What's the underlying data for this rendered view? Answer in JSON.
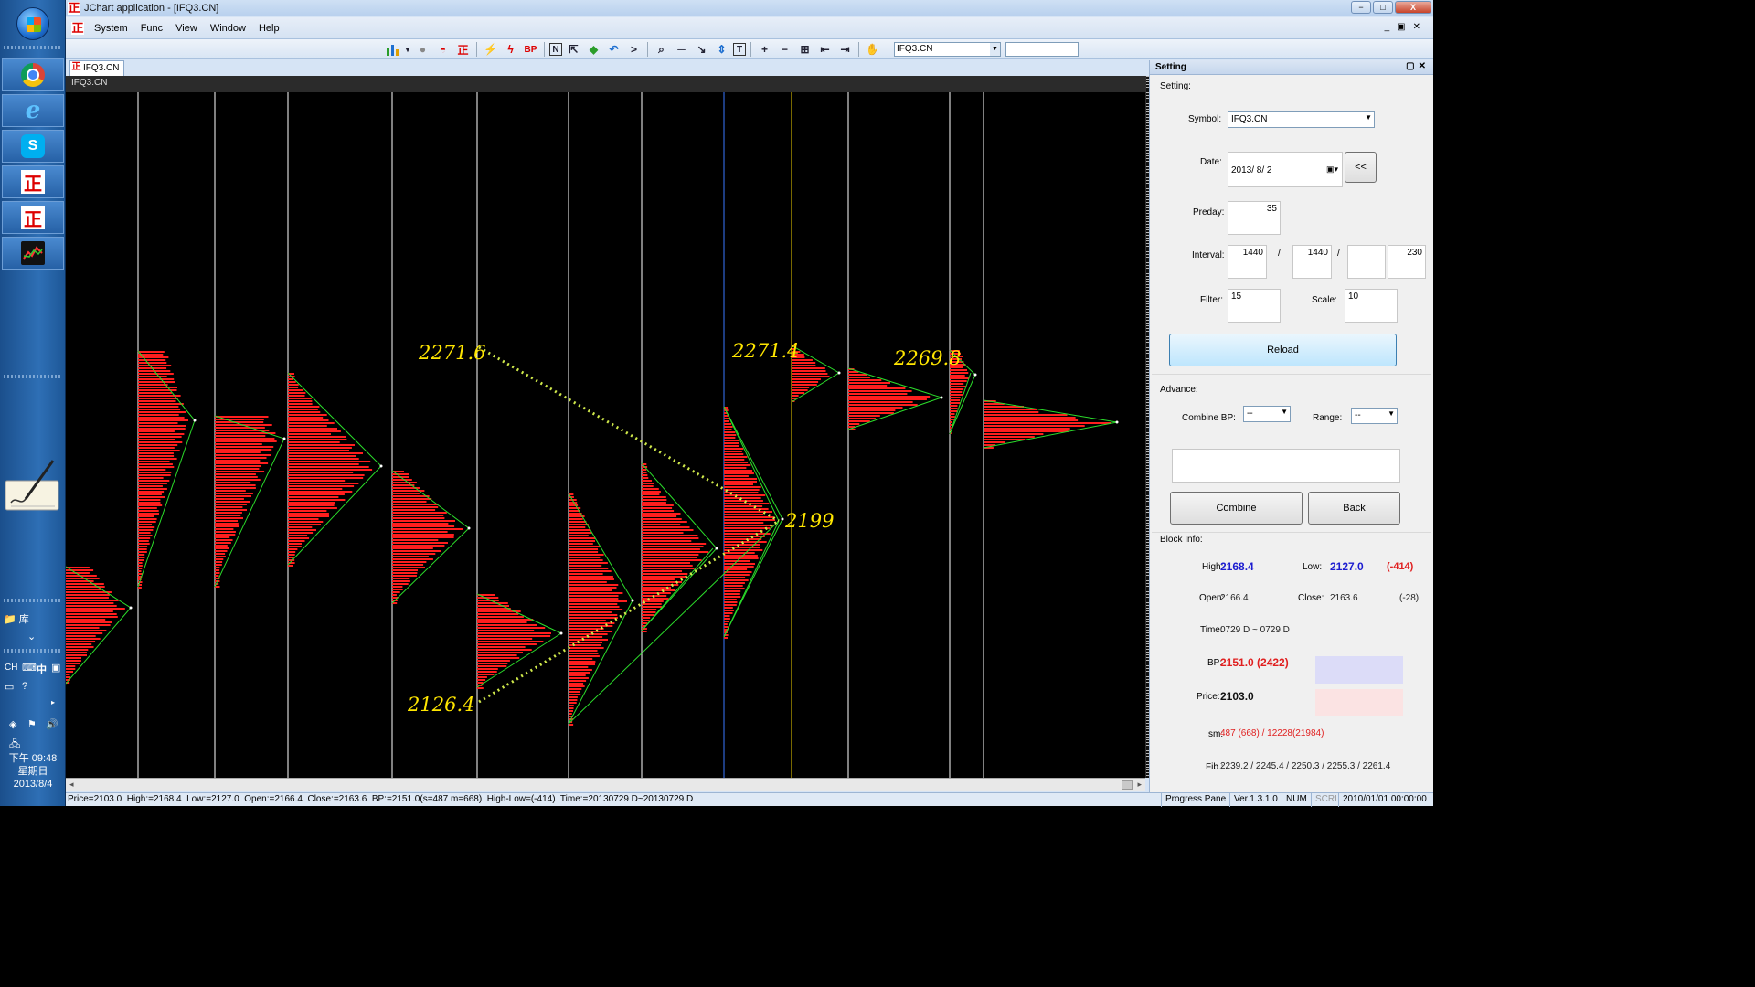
{
  "taskbar": {
    "language": "CH",
    "ime": "中",
    "library_label": "库",
    "clock": {
      "time": "下午 09:48",
      "weekday": "星期日",
      "date": "2013/8/4"
    }
  },
  "window": {
    "title": "JChart application - [IFQ3.CN]",
    "min_label": "−",
    "max_label": "□",
    "close_label": "X"
  },
  "menu": [
    "System",
    "Func",
    "View",
    "Window",
    "Help"
  ],
  "toolbar": {
    "bp_label": "BP",
    "symbol_combo": "IFQ3.CN",
    "search_value": ""
  },
  "document": {
    "tab_label": "IFQ3.CN",
    "header_label": "IFQ3.CN"
  },
  "chart_data": {
    "type": "market-profile",
    "annotations": [
      {
        "label": "2271.6",
        "kind": "high"
      },
      {
        "label": "2126.4",
        "kind": "low"
      },
      {
        "label": "2271.4",
        "kind": "high"
      },
      {
        "label": "2199",
        "kind": "pivot"
      },
      {
        "label": "2269.8",
        "kind": "high"
      }
    ],
    "separator_colors": {
      "default": "#ffffff",
      "blue": "#3a78ff",
      "yellow": "#f0d000"
    },
    "profile_color": "#ff1e1e",
    "trend_line_color": "#2bdc2b",
    "dotted_line_color": "#cfe84a",
    "label_color": "#ffe600"
  },
  "statusbar": {
    "price": "Price=2103.0",
    "high": "High:=2168.4",
    "low": "Low:=2127.0",
    "open": "Open:=2166.4",
    "close": "Close:=2163.6",
    "bp": "BP:=2151.0(s=487 m=668)",
    "high_low": "High-Low=(-414)",
    "time": "Time:=20130729 D~20130729 D",
    "progress_label": "Progress Pane",
    "version": "Ver.1.3.1.0",
    "num": "NUM",
    "scrl": "SCRL",
    "datetime": "2010/01/01 00:00:00"
  },
  "setting": {
    "title": "Setting",
    "section_setting": "Setting:",
    "symbol_label": "Symbol:",
    "symbol_value": "IFQ3.CN",
    "date_label": "Date:",
    "date_value": "2013/  8/  2",
    "back_date_label": "<<",
    "preday_label": "Preday:",
    "preday_value": "35",
    "interval_label": "Interval:",
    "interval_1": "1440",
    "interval_sep": "/",
    "interval_2": "1440",
    "interval_3": "",
    "interval_4": "230",
    "filter_label": "Filter:",
    "filter_value": "15",
    "scale_label": "Scale:",
    "scale_value": "10",
    "reload_label": "Reload",
    "section_advance": "Advance:",
    "combine_bp_label": "Combine BP:",
    "combine_bp_value": "--",
    "range_label": "Range:",
    "range_value": "--",
    "combine_label": "Combine",
    "back_label": "Back",
    "section_block": "Block Info:",
    "high_label": "High:",
    "high_value": "2168.4",
    "low_label": "Low:",
    "low_value": "2127.0",
    "diff_value": "(-414)",
    "open_label": "Open:",
    "open_value": "2166.4",
    "close_label": "Close:",
    "close_value": "2163.6",
    "close_diff": "(-28)",
    "time_label": "Time:",
    "time_value": "0729 D ~ 0729 D",
    "bp_label": "BP:",
    "bp_value": "2151.0 (2422)",
    "price_label": "Price:",
    "price_value": "2103.0",
    "sm_label": "sm:",
    "sm_value": "487 (668) / 12228(21984)",
    "fib_label": "Fib.:",
    "fib_value": "2239.2 / 2245.4 / 2250.3 / 2255.3 / 2261.4",
    "bp_swatch_color": "#dcdcf8",
    "price_swatch_color": "#fbe3e3"
  }
}
